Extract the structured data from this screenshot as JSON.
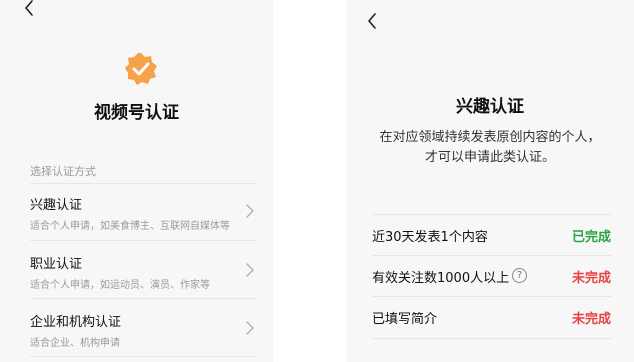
{
  "left_panel": {
    "title": "视频号认证",
    "section_label": "选择认证方式",
    "options": [
      {
        "name": "兴趣认证",
        "desc": "适合个人申请，如美食博主、互联网自媒体等"
      },
      {
        "name": "职业认证",
        "desc": "适合个人申请，如运动员、演员、作家等"
      },
      {
        "name": "企业和机构认证",
        "desc": "适合企业、机构申请"
      }
    ]
  },
  "right_panel": {
    "title": "兴趣认证",
    "intro_line1": "在对应领域持续发表原创内容的个人，",
    "intro_line2": "才可以申请此类认证。",
    "requirements": [
      {
        "label": "近30天发表1个内容",
        "status": "已完成",
        "status_color": "#2ba245"
      },
      {
        "label": "有效关注数1000人以上",
        "status": "未完成",
        "status_color": "#e64340",
        "help": "?"
      },
      {
        "label": "已填写简介",
        "status": "未完成",
        "status_color": "#e64340"
      }
    ]
  },
  "colors": {
    "badge": "#f5a24b",
    "completed": "#2ba245",
    "incomplete": "#e64340"
  },
  "icons": [
    "back-arrow-icon",
    "verified-badge-icon",
    "chevron-right-icon",
    "question-mark-icon"
  ]
}
